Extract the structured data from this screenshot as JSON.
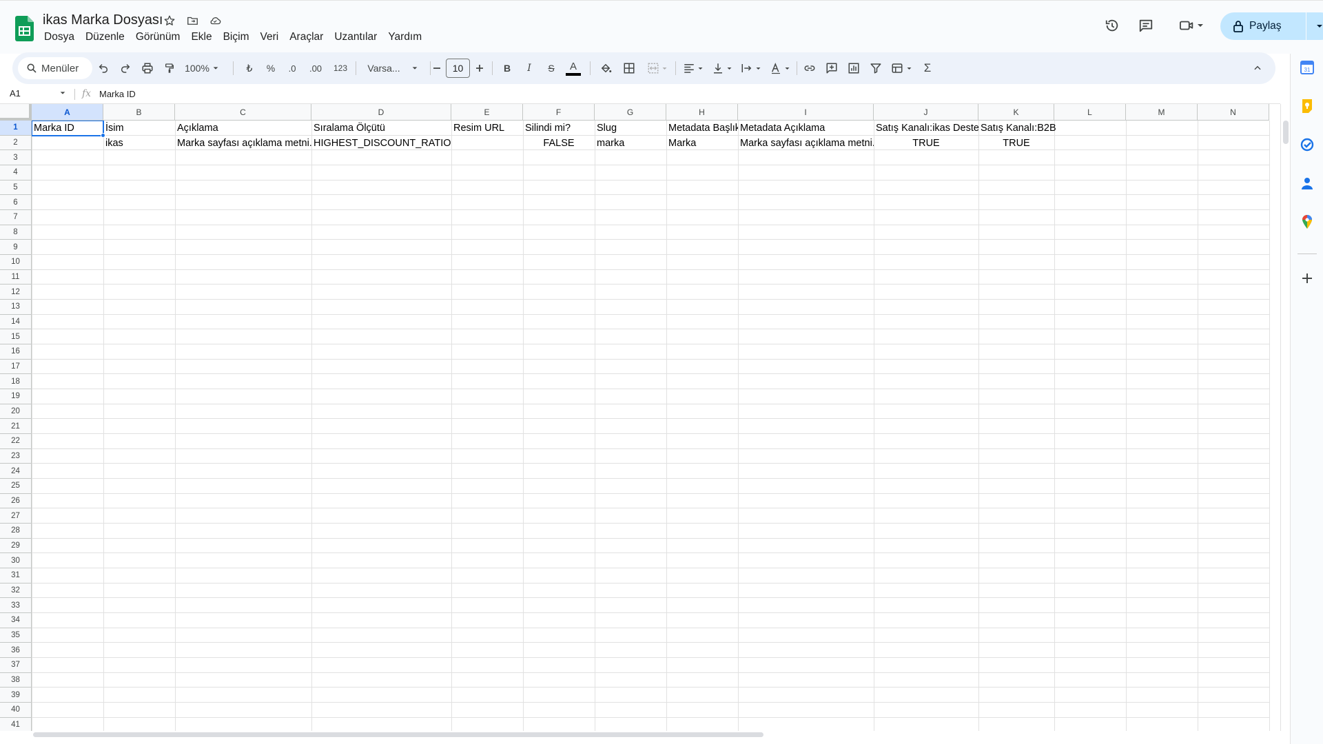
{
  "app": {
    "title": "ikas Marka Dosyası",
    "accent": "#0f9d58"
  },
  "menu": [
    "Dosya",
    "Düzenle",
    "Görünüm",
    "Ekle",
    "Biçim",
    "Veri",
    "Araçlar",
    "Uzantılar",
    "Yardım"
  ],
  "header": {
    "share_label": "Paylaş",
    "share_bg": "#c2e7ff"
  },
  "toolbar": {
    "menus_label": "Menüler",
    "zoom": "100%",
    "currency": "₺",
    "percent": "%",
    "dec_decrease": ".0",
    "dec_increase": ".00",
    "number_format": "123",
    "font": "Varsa...",
    "font_size": "10",
    "bold": "B",
    "italic": "I",
    "strike": "S",
    "text_color_label": "A",
    "function": "Σ"
  },
  "formula": {
    "cell_ref": "A1",
    "fx": "fx",
    "value": "Marka ID"
  },
  "grid": {
    "columns": [
      "A",
      "B",
      "C",
      "D",
      "E",
      "F",
      "G",
      "H",
      "I",
      "J",
      "K",
      "L",
      "M",
      "N"
    ],
    "active_column": "A",
    "rows": [
      "1",
      "2",
      "3",
      "4",
      "5",
      "6",
      "7",
      "8",
      "9",
      "10",
      "11",
      "12",
      "13",
      "14",
      "15",
      "16",
      "17",
      "18",
      "19",
      "20",
      "21",
      "22",
      "23",
      "24",
      "25",
      "26",
      "27",
      "28",
      "29",
      "30",
      "31",
      "32",
      "33",
      "34",
      "35",
      "36",
      "37",
      "38",
      "39",
      "40",
      "41"
    ],
    "active_row": "1",
    "data": [
      [
        "Marka ID",
        "İsim",
        "Açıklama",
        "Sıralama Ölçütü",
        "Resim URL",
        "Silindi mi?",
        "Slug",
        "Metadata Başlık",
        "Metadata Açıklama",
        "Satış Kanalı:ikas Destek",
        "Satış Kanalı:B2B",
        "",
        "",
        ""
      ],
      [
        "",
        "ikas",
        "Marka sayfası açıklama metni.",
        "HIGHEST_DISCOUNT_RATIO",
        "",
        "FALSE",
        "marka",
        "Marka",
        "Marka sayfası açıklama metni.",
        "TRUE",
        "TRUE",
        "",
        "",
        ""
      ]
    ]
  },
  "side_panel": [
    "calendar-icon",
    "keep-icon",
    "tasks-icon",
    "contacts-icon",
    "maps-icon",
    "add-icon"
  ]
}
